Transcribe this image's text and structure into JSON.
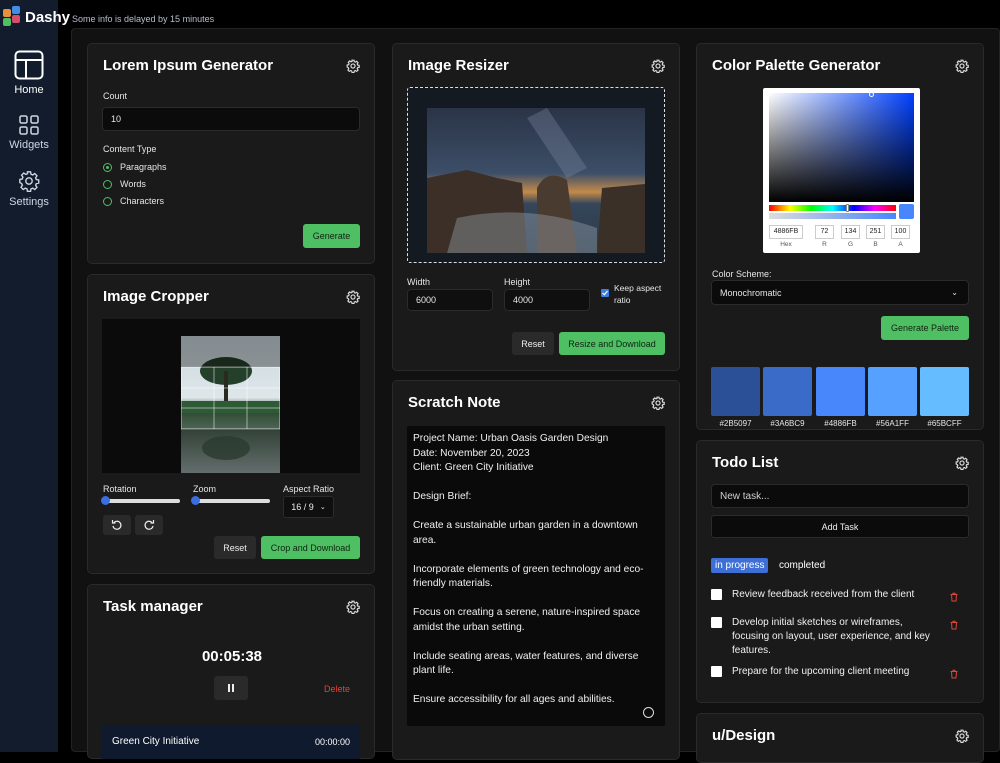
{
  "app": {
    "name": "Dashy",
    "notice": "Some info is delayed by 15 minutes"
  },
  "sidebar": {
    "items": [
      {
        "label": "Home",
        "icon": "layout-icon"
      },
      {
        "label": "Widgets",
        "icon": "grid-icon"
      },
      {
        "label": "Settings",
        "icon": "gear-icon"
      }
    ]
  },
  "lorem": {
    "title": "Lorem Ipsum Generator",
    "count_label": "Count",
    "count_value": "10",
    "type_label": "Content Type",
    "options": [
      "Paragraphs",
      "Words",
      "Characters"
    ],
    "selected": "Paragraphs",
    "generate": "Generate"
  },
  "cropper": {
    "title": "Image Cropper",
    "rotation_label": "Rotation",
    "zoom_label": "Zoom",
    "aspect_label": "Aspect Ratio",
    "aspect_value": "16 / 9",
    "reset": "Reset",
    "crop": "Crop and Download"
  },
  "task": {
    "title": "Task manager",
    "timer": "00:05:38",
    "delete": "Delete",
    "item_name": "Green City Initiative",
    "item_time": "00:00:00"
  },
  "resizer": {
    "title": "Image Resizer",
    "width_label": "Width",
    "width_value": "6000",
    "height_label": "Height",
    "height_value": "4000",
    "keep_label": "Keep aspect ratio",
    "keep_checked": true,
    "reset": "Reset",
    "resize": "Resize and Download"
  },
  "scratch": {
    "title": "Scratch Note",
    "text": "Project Name: Urban Oasis Garden Design\nDate: November 20, 2023\nClient: Green City Initiative\n\nDesign Brief:\n\nCreate a sustainable urban garden in a downtown area.\n\nIncorporate elements of green technology and eco-friendly materials.\n\nFocus on creating a serene, nature-inspired space amidst the urban setting.\n\nInclude seating areas, water features, and diverse plant life.\n\nEnsure accessibility for all ages and abilities."
  },
  "palette": {
    "title": "Color Palette Generator",
    "picker": {
      "hex": "4886FB",
      "r": "72",
      "g": "134",
      "b": "251",
      "a": "100",
      "hex_label": "Hex",
      "r_label": "R",
      "g_label": "G",
      "b_label": "B",
      "a_label": "A"
    },
    "scheme_label": "Color Scheme:",
    "scheme_value": "Monochromatic",
    "generate": "Generate Palette",
    "swatches": [
      {
        "hex": "#2B5097",
        "label": "#2B5097"
      },
      {
        "hex": "#3A6BC9",
        "label": "#3A6BC9"
      },
      {
        "hex": "#4886FB",
        "label": "#4886FB"
      },
      {
        "hex": "#56A1FF",
        "label": "#56A1FF"
      },
      {
        "hex": "#65BCFF",
        "label": "#65BCFF"
      }
    ]
  },
  "todo": {
    "title": "Todo List",
    "placeholder": "New task...",
    "add": "Add Task",
    "tab_active": "in progress",
    "tab_other": "completed",
    "items": [
      "Review feedback received from the client",
      "Develop initial sketches or wireframes, focusing on layout, user experience, and key features.",
      "Prepare for the upcoming client meeting"
    ]
  },
  "udesign": {
    "title": "u/Design"
  },
  "colors": {
    "accent_green": "#4fbf63",
    "sidebar": "#121c2c",
    "card": "#1a1a1a",
    "danger": "#e0443a",
    "tab_blue": "#3d6fd6"
  }
}
